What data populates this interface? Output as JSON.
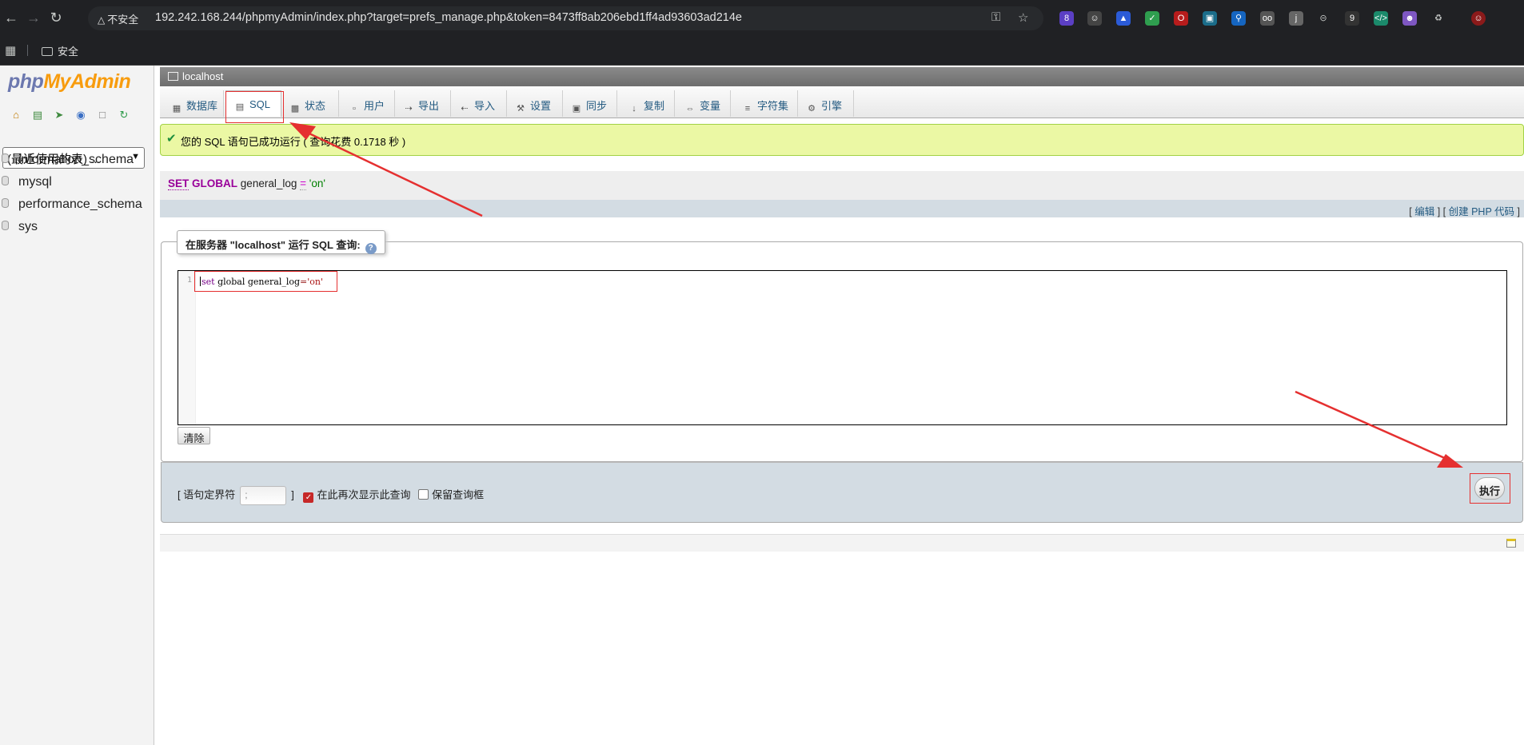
{
  "browser": {
    "insecure_label": "不安全",
    "url": "192.242.168.244/phpmyAdmin/index.php?target=prefs_manage.php&token=8473ff8ab206ebd1ff4ad93603ad214e",
    "bookmark_folder": "安全",
    "ext_badges": [
      "8",
      "9"
    ]
  },
  "left": {
    "logo_php": "php",
    "logo_my": "MyAdmin",
    "recent_tables": "(最近使用的表) ...",
    "databases": [
      "information_schema",
      "mysql",
      "performance_schema",
      "sys"
    ]
  },
  "breadcrumb": {
    "server": "localhost"
  },
  "tabs": [
    {
      "label": "数据库",
      "icon": "database-icon"
    },
    {
      "label": "SQL",
      "icon": "sql-icon"
    },
    {
      "label": "状态",
      "icon": "status-icon"
    },
    {
      "label": "用户",
      "icon": "users-icon"
    },
    {
      "label": "导出",
      "icon": "export-icon"
    },
    {
      "label": "导入",
      "icon": "import-icon"
    },
    {
      "label": "设置",
      "icon": "wrench-icon"
    },
    {
      "label": "同步",
      "icon": "sync-icon"
    },
    {
      "label": "复制",
      "icon": "replication-icon"
    },
    {
      "label": "变量",
      "icon": "variables-icon"
    },
    {
      "label": "字符集",
      "icon": "charset-icon"
    },
    {
      "label": "引擎",
      "icon": "engine-icon"
    }
  ],
  "success": {
    "message": "您的 SQL 语句已成功运行 ( 查询花费 0.1718 秒 )"
  },
  "executed_sql": {
    "kw1": "SET",
    "kw2": "GLOBAL",
    "name": "general_log",
    "op": "=",
    "value": "'on'"
  },
  "edit_links": {
    "edit": "编辑",
    "create_php": "创建 PHP 代码"
  },
  "query_box": {
    "legend": "在服务器 \"localhost\" 运行 SQL 查询:",
    "line_no": "1",
    "code_kw": "set",
    "code_rest": " global general_log",
    "code_op": "=",
    "code_val": "'on'",
    "clear": "清除"
  },
  "options": {
    "delimiter_label": "[ 语句定界符",
    "delimiter_value": ";",
    "delimiter_close": "]",
    "show_again": "在此再次显示此查询",
    "show_again_checked": true,
    "keep_box": "保留查询框",
    "keep_box_checked": false,
    "go": "执行"
  },
  "colors": {
    "success_bg": "#ebf8a4",
    "annotation": "#e53030",
    "keyword": "#990099"
  }
}
